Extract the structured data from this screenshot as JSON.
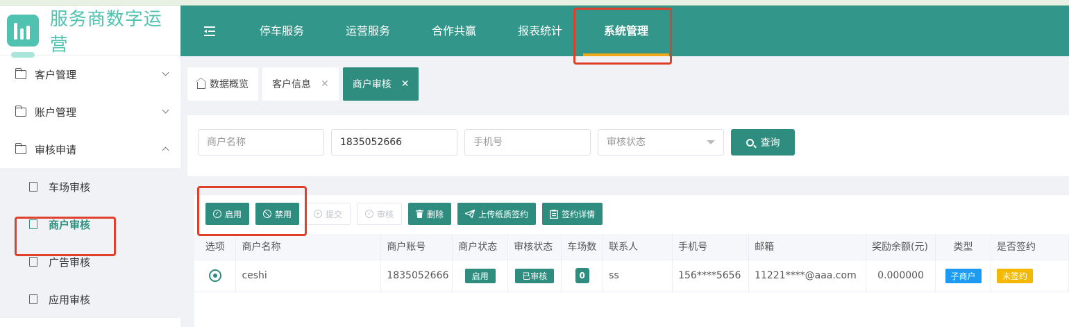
{
  "app": {
    "title": "服务商数字运营"
  },
  "header": {
    "nav": [
      "停车服务",
      "运营服务",
      "合作共赢",
      "报表统计",
      "系统管理"
    ],
    "active_nav": "系统管理"
  },
  "sidebar": {
    "groups": [
      {
        "label": "客户管理",
        "expanded": false
      },
      {
        "label": "账户管理",
        "expanded": false
      },
      {
        "label": "审核申请",
        "expanded": true
      }
    ],
    "subitems": [
      "车场审核",
      "商户审核",
      "广告审核",
      "应用审核"
    ],
    "active_subitem": "商户审核"
  },
  "tabs": {
    "items": [
      "数据概览",
      "客户信息",
      "商户审核"
    ],
    "active": "商户审核"
  },
  "search": {
    "merchant_name_placeholder": "商户名称",
    "account_value": "1835052666",
    "phone_placeholder": "手机号",
    "status_placeholder": "审核状态",
    "query_label": "查询"
  },
  "toolbar": {
    "enable": "启用",
    "disable": "禁用",
    "submit": "提交",
    "review": "审核",
    "delete": "删除",
    "upload_sign": "上传纸质签约",
    "sign_detail": "签约详情"
  },
  "table": {
    "columns": [
      "选项",
      "商户名称",
      "商户账号",
      "商户状态",
      "审核状态",
      "车场数",
      "联系人",
      "手机号",
      "邮箱",
      "奖励余额(元)",
      "类型",
      "是否签约"
    ],
    "rows": [
      {
        "name": "ceshi",
        "account": "1835052666",
        "merchant_status": "启用",
        "audit_status": "已审核",
        "lot_count": "0",
        "contact": "ss",
        "phone": "156****5656",
        "email": "11221****@aaa.com",
        "reward_balance": "0.000000",
        "type": "子商户",
        "signed": "未签约"
      }
    ]
  },
  "colors": {
    "primary": "#2f8d80",
    "header_bg": "#32968a",
    "highlight_box": "#e0402a",
    "nav_underline": "#f0a818",
    "type_badge": "#1e9bf0",
    "unsigned_badge": "#f5b800"
  }
}
